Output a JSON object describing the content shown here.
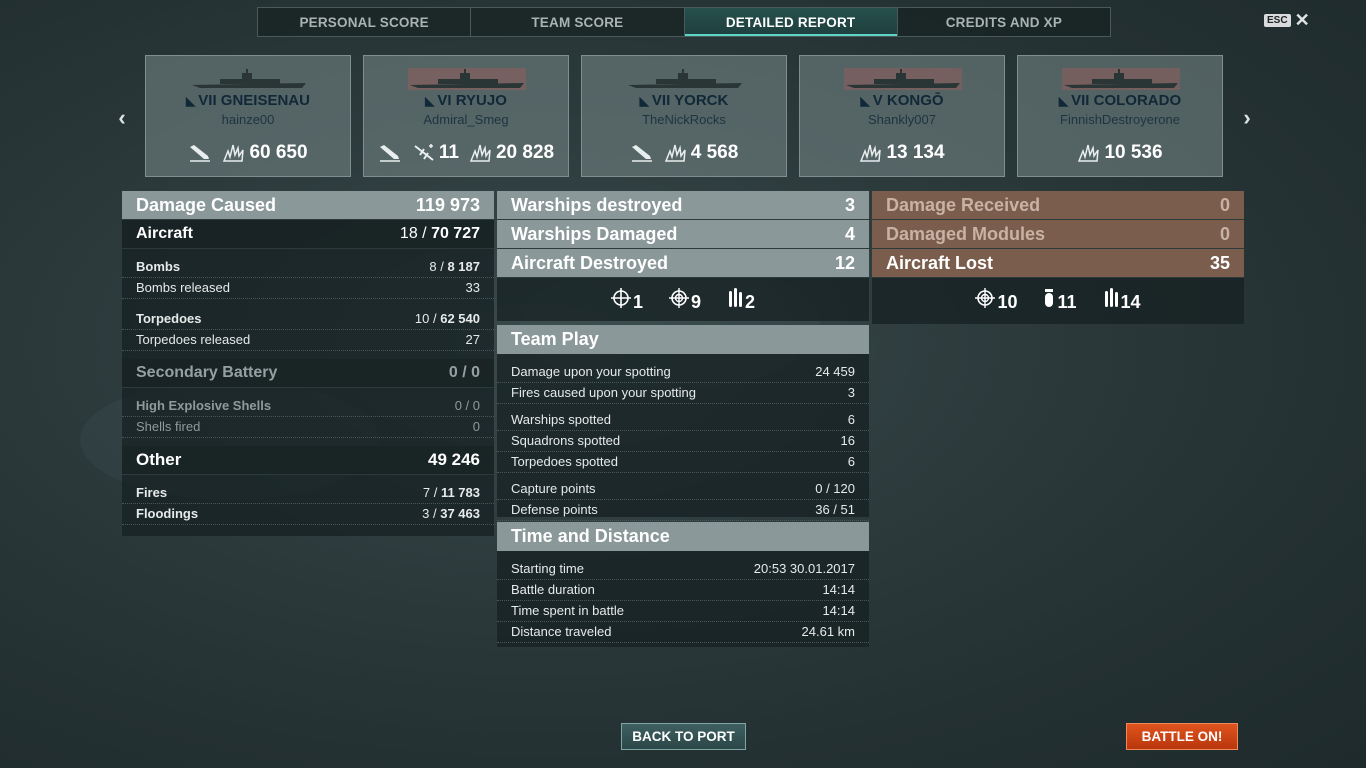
{
  "tabs": [
    "PERSONAL SCORE",
    "TEAM SCORE",
    "DETAILED REPORT",
    "CREDITS AND XP"
  ],
  "esc_label": "ESC",
  "cards": [
    {
      "tier": "VII",
      "ship": "GNEISENAU",
      "player": "hainze00",
      "stats": [
        {
          "icon": "ship-sunk-icon",
          "value": ""
        },
        {
          "icon": "explosion-damage-icon",
          "value": "60 650"
        }
      ]
    },
    {
      "tier": "VI",
      "ship": "RYUJO",
      "player": "Admiral_Smeg",
      "stats": [
        {
          "icon": "ship-sunk-icon",
          "value": ""
        },
        {
          "icon": "plane-shot-icon",
          "value": "11"
        },
        {
          "icon": "explosion-damage-icon",
          "value": "20 828"
        }
      ]
    },
    {
      "tier": "VII",
      "ship": "YORCK",
      "player": "TheNickRocks",
      "stats": [
        {
          "icon": "ship-sunk-icon",
          "value": ""
        },
        {
          "icon": "explosion-damage-icon",
          "value": "4 568"
        }
      ]
    },
    {
      "tier": "V",
      "ship": "KONGŌ",
      "player": "Shankly007",
      "stats": [
        {
          "icon": "explosion-damage-icon",
          "value": "13 134"
        }
      ]
    },
    {
      "tier": "VII",
      "ship": "COLORADO",
      "player": "FinnishDestroyerone",
      "stats": [
        {
          "icon": "explosion-damage-icon",
          "value": "10 536"
        }
      ]
    }
  ],
  "damage": {
    "title": "Damage Caused",
    "total": "119 973",
    "aircraft": {
      "label": "Aircraft",
      "hits": "18",
      "dmg": "70 727"
    },
    "bombs": {
      "label": "Bombs",
      "hits": "8",
      "dmg": "8 187"
    },
    "bombs_released": {
      "label": "Bombs released",
      "value": "33"
    },
    "torpedoes": {
      "label": "Torpedoes",
      "hits": "10",
      "dmg": "62 540"
    },
    "torpedoes_released": {
      "label": "Torpedoes released",
      "value": "27"
    },
    "secondary": {
      "label": "Secondary Battery",
      "value": "0 / 0"
    },
    "he_shells": {
      "label": "High Explosive Shells",
      "value": "0 / 0"
    },
    "shells_fired": {
      "label": "Shells fired",
      "value": "0"
    },
    "other": {
      "label": "Other",
      "value": "49 246"
    },
    "fires": {
      "label": "Fires",
      "hits": "7",
      "dmg": "11 783"
    },
    "floodings": {
      "label": "Floodings",
      "hits": "3",
      "dmg": "37 463"
    }
  },
  "mid": {
    "warships_destroyed": {
      "label": "Warships destroyed",
      "value": "3"
    },
    "warships_damaged": {
      "label": "Warships Damaged",
      "value": "4"
    },
    "aircraft_destroyed": {
      "label": "Aircraft Destroyed",
      "value": "12"
    },
    "icons": [
      {
        "icon": "crosshair-icon",
        "value": "1"
      },
      {
        "icon": "crosshair-double-icon",
        "value": "9"
      },
      {
        "icon": "torpedo-icon",
        "value": "2"
      }
    ],
    "team_play": {
      "title": "Team Play",
      "rows": [
        {
          "label": "Damage upon your spotting",
          "value": "24 459"
        },
        {
          "label": "Fires caused upon your spotting",
          "value": "3"
        },
        {
          "label": "Warships spotted",
          "value": "6"
        },
        {
          "label": "Squadrons spotted",
          "value": "16"
        },
        {
          "label": "Torpedoes spotted",
          "value": "6"
        },
        {
          "label": "Capture points",
          "value": "0 / 120"
        },
        {
          "label": "Defense points",
          "value": "36 / 51"
        }
      ]
    },
    "time": {
      "title": "Time and Distance",
      "rows": [
        {
          "label": "Starting time",
          "value": "20:53  30.01.2017"
        },
        {
          "label": "Battle duration",
          "value": "14:14"
        },
        {
          "label": "Time spent in battle",
          "value": "14:14"
        },
        {
          "label": "Distance traveled",
          "value": "24.61 km"
        }
      ]
    }
  },
  "received": {
    "damage_received": {
      "label": "Damage Received",
      "value": "0"
    },
    "damaged_modules": {
      "label": "Damaged Modules",
      "value": "0"
    },
    "aircraft_lost": {
      "label": "Aircraft Lost",
      "value": "35"
    },
    "icons": [
      {
        "icon": "crosshair-double-icon",
        "value": "10"
      },
      {
        "icon": "bomb-icon",
        "value": "11"
      },
      {
        "icon": "torpedo-icon",
        "value": "14"
      }
    ]
  },
  "buttons": {
    "back": "BACK TO PORT",
    "battle": "BATTLE ON!"
  }
}
